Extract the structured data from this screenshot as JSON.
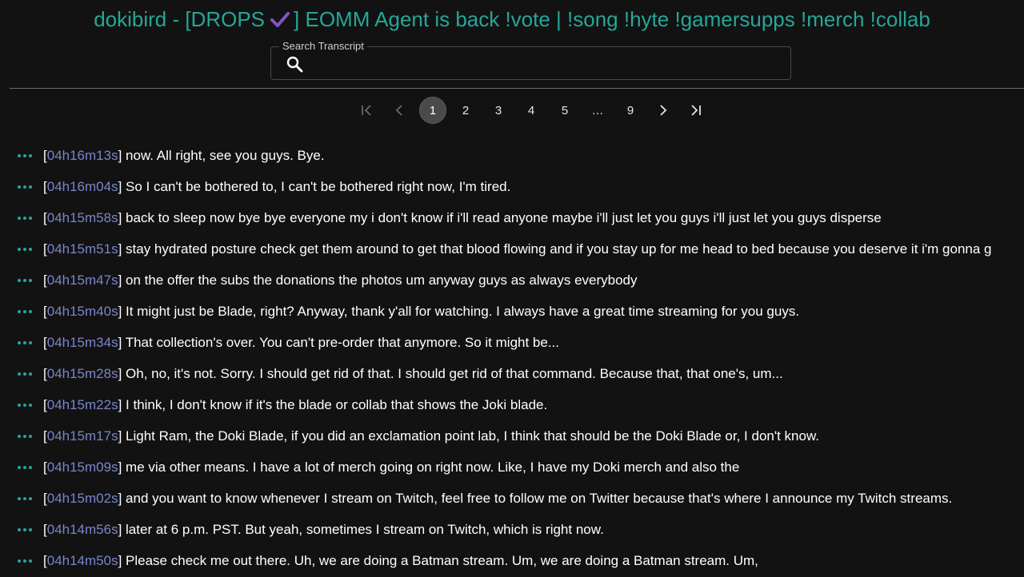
{
  "header": {
    "title_prefix": "dokibird - [DROPS",
    "title_suffix": "] EOMM Agent is back !vote | !song !hyte !gamersupps !merch !collab",
    "check_icon": "check-mark-icon"
  },
  "search": {
    "label": "Search Transcript",
    "value": "",
    "icon": "search-icon"
  },
  "pagination": {
    "first_icon": "first-page-icon",
    "prev_icon": "chevron-left-icon",
    "pages": [
      "1",
      "2",
      "3",
      "4",
      "5",
      "…",
      "9"
    ],
    "current": "1",
    "next_icon": "chevron-right-icon",
    "last_icon": "last-page-icon"
  },
  "transcript": {
    "row_menu_icon": "more-horizontal-icon",
    "entries": [
      {
        "timestamp": "04h16m13s",
        "text": "now. All right, see you guys. Bye."
      },
      {
        "timestamp": "04h16m04s",
        "text": "So I can't be bothered to, I can't be bothered right now, I'm tired."
      },
      {
        "timestamp": "04h15m58s",
        "text": "back to sleep now bye bye everyone my i don't know if i'll read anyone maybe i'll just let you guys i'll just let you guys disperse"
      },
      {
        "timestamp": "04h15m51s",
        "text": "stay hydrated posture check get them around to get that blood flowing and if you stay up for me head to bed because you deserve it i'm gonna g"
      },
      {
        "timestamp": "04h15m47s",
        "text": "on the offer the subs the donations the photos um anyway guys as always everybody"
      },
      {
        "timestamp": "04h15m40s",
        "text": "It might just be Blade, right? Anyway, thank y'all for watching. I always have a great time streaming for you guys."
      },
      {
        "timestamp": "04h15m34s",
        "text": "That collection's over. You can't pre-order that anymore. So it might be..."
      },
      {
        "timestamp": "04h15m28s",
        "text": "Oh, no, it's not. Sorry. I should get rid of that. I should get rid of that command. Because that, that one's, um..."
      },
      {
        "timestamp": "04h15m22s",
        "text": "I think, I don't know if it's the blade or collab that shows the Joki blade."
      },
      {
        "timestamp": "04h15m17s",
        "text": "Light Ram, the Doki Blade, if you did an exclamation point lab, I think that should be the Doki Blade or, I don't know."
      },
      {
        "timestamp": "04h15m09s",
        "text": "me via other means. I have a lot of merch going on right now. Like, I have my Doki merch and also the"
      },
      {
        "timestamp": "04h15m02s",
        "text": "and you want to know whenever I stream on Twitch, feel free to follow me on Twitter because that's where I announce my Twitch streams."
      },
      {
        "timestamp": "04h14m56s",
        "text": "later at 6 p.m. PST. But yeah, sometimes I stream on Twitch, which is right now."
      },
      {
        "timestamp": "04h14m50s",
        "text": "Please check me out there. Uh, we are doing a Batman stream. Um, we are doing a Batman stream. Um,"
      }
    ]
  },
  "colors": {
    "background": "#121212",
    "title": "#26a69a",
    "timestamp": "#7986cb",
    "accent_icon": "#26a69a",
    "check": "#7e57c2"
  }
}
